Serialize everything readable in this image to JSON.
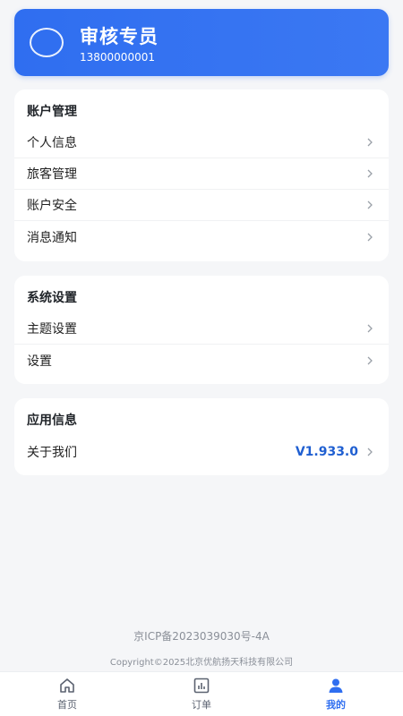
{
  "profile": {
    "name": "审核专员",
    "phone": "13800000001"
  },
  "account_section": {
    "title": "账户管理",
    "items": [
      {
        "label": "个人信息"
      },
      {
        "label": "旅客管理"
      },
      {
        "label": "账户安全"
      },
      {
        "label": "消息通知"
      }
    ]
  },
  "system_section": {
    "title": "系统设置",
    "items": [
      {
        "label": "主题设置"
      },
      {
        "label": "设置"
      }
    ]
  },
  "app_section": {
    "title": "应用信息",
    "items": [
      {
        "label": "关于我们",
        "value": "V1.933.0"
      }
    ]
  },
  "footer": {
    "icp": "京ICP备2023039030号-4A",
    "copyright": "Copyright©2025北京优航扬天科技有限公司"
  },
  "bottom_nav": {
    "items": [
      {
        "label": "首页",
        "icon": "home-icon"
      },
      {
        "label": "订单",
        "icon": "chart-icon"
      },
      {
        "label": "我的",
        "icon": "user-icon",
        "active": true
      }
    ]
  },
  "colors": {
    "accent": "#2f6ef0",
    "version_text": "#1f5fd1",
    "background": "#f5f6f8"
  }
}
